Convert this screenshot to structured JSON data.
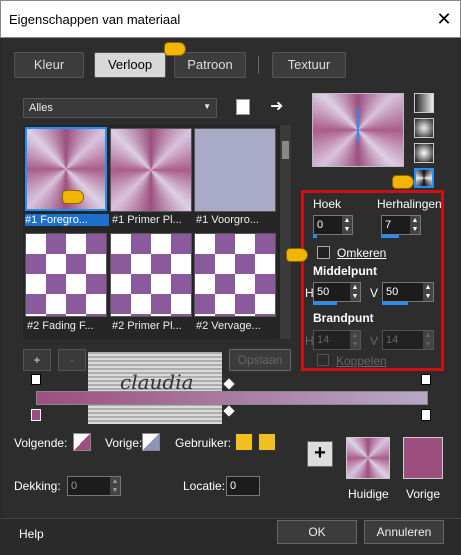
{
  "window": {
    "title": "Eigenschappen van materiaal",
    "close_glyph": "✕"
  },
  "tabs": [
    {
      "label": "Kleur"
    },
    {
      "label": "Verloop"
    },
    {
      "label": "Patroon"
    },
    {
      "label": "Textuur"
    }
  ],
  "active_tab": "Verloop",
  "category": {
    "value": "Alles"
  },
  "gallery": [
    {
      "label": "#1 Foregro...",
      "type": "radial"
    },
    {
      "label": "#1 Primer Pl...",
      "type": "radial"
    },
    {
      "label": "#1 Voorgro...",
      "type": "flat"
    },
    {
      "label": "#2 Fading F...",
      "type": "check"
    },
    {
      "label": "#2 Primer Pl...",
      "type": "check"
    },
    {
      "label": "#2 Vervage...",
      "type": "check"
    }
  ],
  "gallery_buttons": {
    "add": "+",
    "remove": "-",
    "save": "Opslaan"
  },
  "params": {
    "angle_label": "Hoek",
    "angle": "0",
    "repeat_label": "Herhalingen",
    "repeat": "7",
    "invert_label": "Omkeren",
    "center_label": "Middelpunt",
    "center_h_label": "H",
    "center_h": "50",
    "center_v_label": "V",
    "center_v": "50",
    "focal_label": "Brandpunt",
    "focal_h_label": "H",
    "focal_h": "14",
    "focal_v_label": "V",
    "focal_v": "14",
    "link_label": "Koppelen"
  },
  "bottom": {
    "next_label": "Volgende:",
    "prev_label": "Vorige:",
    "user_label": "Gebruiker:",
    "opacity_label": "Dekking:",
    "opacity": "0",
    "location_label": "Locatie:",
    "location": "0",
    "current_label": "Huidige",
    "previous_label": "Vorige",
    "add_glyph": "+"
  },
  "footer": {
    "help": "Help",
    "ok": "OK",
    "cancel": "Annuleren"
  },
  "watermark": {
    "text": "claudia"
  },
  "colors": {
    "accent": "#1e90ff",
    "highlight": "#d01010",
    "pink": "#9c4f7e",
    "lavender": "#d9c2dd",
    "yellow": "#f0c020"
  }
}
